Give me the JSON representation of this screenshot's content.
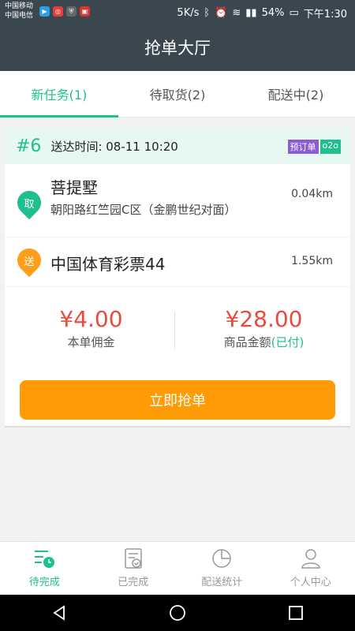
{
  "status_bar": {
    "carrier1": "中国移动",
    "carrier2": "中国电信",
    "speed": "5K/s",
    "battery": "54%",
    "time": "下午1:30"
  },
  "app_bar": {
    "title": "抢单大厅"
  },
  "tabs": [
    {
      "label": "新任务(1)",
      "active": true
    },
    {
      "label": "待取货(2)",
      "active": false
    },
    {
      "label": "配送中(2)",
      "active": false
    }
  ],
  "order": {
    "number": "#6",
    "delivery_time": "送达时间: 08-11 10:20",
    "badge_preorder": "预订单",
    "badge_o2o": "o2o",
    "pickup": {
      "pin_label": "取",
      "name": "菩提墅",
      "detail": "朝阳路红竺园C区（金鹏世纪对面）",
      "distance": "0.04km"
    },
    "dropoff": {
      "pin_label": "送",
      "name": "中国体育彩票44",
      "distance": "1.55km"
    },
    "commission": {
      "value": "¥4.00",
      "label": "本单佣金"
    },
    "goods_amount": {
      "value": "¥28.00",
      "label": "商品金额",
      "status": "(已付)"
    },
    "grab_button": "立即抢单"
  },
  "bottom_nav": [
    {
      "label": "待完成",
      "icon": "pending-list-icon",
      "active": true
    },
    {
      "label": "已完成",
      "icon": "completed-doc-icon",
      "active": false
    },
    {
      "label": "配送统计",
      "icon": "pie-chart-icon",
      "active": false
    },
    {
      "label": "个人中心",
      "icon": "user-icon",
      "active": false
    }
  ],
  "colors": {
    "accent": "#1fbf8f",
    "price": "#e94b3c",
    "button": "#ff9b05",
    "header": "#3a474e"
  }
}
